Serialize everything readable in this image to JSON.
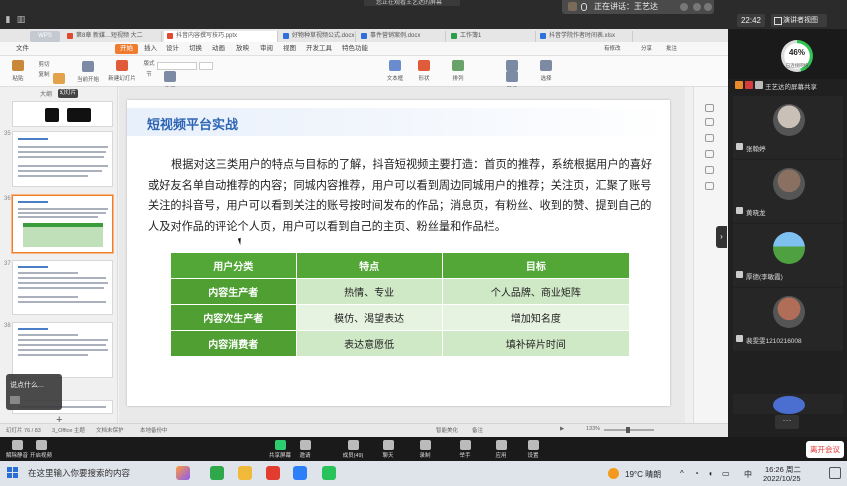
{
  "screen": {
    "share_hint": "您正在观看王艺达的屏幕",
    "speaking": {
      "label": "正在讲话：王艺达"
    },
    "time_pill": "22:42",
    "view_button": "演讲者视图"
  },
  "wps": {
    "brand": "WPS",
    "tabs": [
      {
        "label": "第8章 新媒…短视频 大二",
        "color": "#e24a2f"
      },
      {
        "label": "抖音内容撰写技巧.pptx",
        "color": "#e24a2f"
      },
      {
        "label": "好物种草视频公式.docx",
        "color": "#2f6fdb"
      },
      {
        "label": "事件营销案例.docx",
        "color": "#2f6fdb"
      },
      {
        "label": "工作簿1",
        "color": "#2a9d4b"
      },
      {
        "label": "抖音学院作者时间表.xlsx",
        "color": "#2f6fdb"
      }
    ],
    "menus": [
      "文件",
      "开始",
      "插入",
      "设计",
      "切换",
      "动画",
      "放映",
      "审阅",
      "视图",
      "开发工具",
      "特色功能"
    ],
    "active_menu": "开始",
    "right_menus": [
      "有修改",
      "分享",
      "批注"
    ],
    "tools": [
      "粘贴",
      "剪切",
      "复制",
      "格式刷",
      "当前开始",
      "新建幻灯片",
      "版式",
      "节",
      "重置",
      "文本框",
      "形状",
      "排列",
      "查找",
      "替换",
      "选择"
    ],
    "left_pane": {
      "label": "大纲",
      "tag": "幻灯片",
      "slide_numbers": [
        "35",
        "36",
        "37",
        "38"
      ],
      "chat_popup": "说点什么..."
    },
    "status": {
      "slide_count": "幻灯片 76 / 83",
      "theme": "3_Office 主题",
      "doc_protect": "文档未保护",
      "backup": "本地备份中",
      "notes": "智能美化",
      "comment": "备注",
      "zoom": "133%"
    }
  },
  "slide": {
    "title": "短视频平台实战",
    "paragraph": "根据对这三类用户的特点与目标的了解，抖音短视频主要打造：首页的推荐，系统根据用户的喜好或好友名单自动推荐的内容；同城内容推荐，用户可以看到周边同城用户的推荐；关注页，汇聚了账号关注的抖音号，用户可以看到关注的账号按时间发布的作品；消息页，有粉丝、收到的赞、提到自己的人及对作品的评论个人页，用户可以看到自己的主页、粉丝量和作品栏。",
    "table": {
      "headers": [
        "用户分类",
        "特点",
        "目标"
      ],
      "rows": [
        [
          "内容生产者",
          "热情、专业",
          "个人品牌、商业矩阵"
        ],
        [
          "内容次生产者",
          "模仿、渴望表达",
          "增加知名度"
        ],
        [
          "内容消费者",
          "表达意愿低",
          "填补碎片时间"
        ]
      ]
    }
  },
  "meeting": {
    "ring_value": "46%",
    "ring_sub": "已连接网络",
    "share_label": "王艺达的屏幕共享",
    "participants": [
      {
        "name": "张翰婷",
        "color": "#c9c0b8"
      },
      {
        "name": "黄晓龙",
        "color": "#8a7060"
      },
      {
        "name": "厚德(李敏霞)",
        "color": "#5aa04a"
      },
      {
        "name": "裴雯雯1210216008",
        "color": "#b06e58"
      }
    ],
    "more_indicator": "···",
    "toolbar": {
      "left": [
        "解除静音",
        "开启视频"
      ],
      "center": [
        {
          "label": "共享屏幕",
          "active": true
        },
        {
          "label": "邀请",
          "active": false
        },
        {
          "label": "成员(49)",
          "active": false
        },
        {
          "label": "聊天",
          "active": false
        },
        {
          "label": "录制",
          "active": false
        },
        {
          "label": "举手",
          "active": false
        },
        {
          "label": "应用",
          "active": false
        },
        {
          "label": "设置",
          "active": false
        }
      ],
      "leave": "离开会议"
    }
  },
  "taskbar": {
    "search_placeholder": "在这里输入你要搜索的内容",
    "weather": "19°C 晴朗",
    "ime": "中",
    "clock_time": "16:26 周二",
    "clock_date": "2022/10/25"
  }
}
